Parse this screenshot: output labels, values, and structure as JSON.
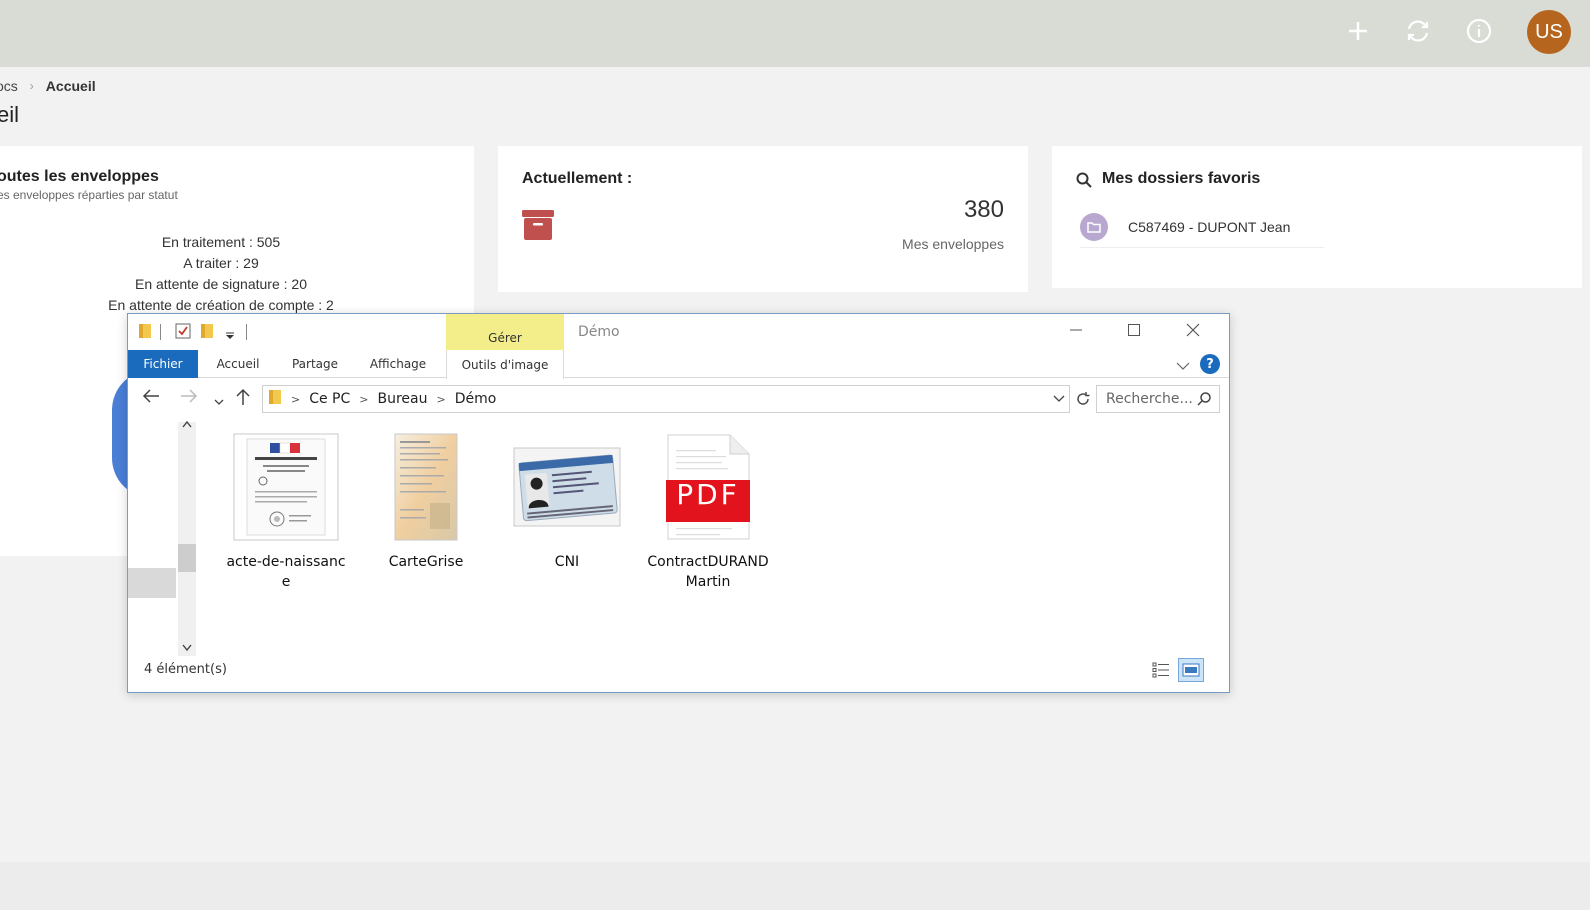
{
  "topbar": {
    "icons": [
      "plus-icon",
      "sync-icon",
      "info-icon"
    ],
    "avatar_initials": "US",
    "avatar_color": "#b5651d",
    "background": "#d8dcd4"
  },
  "breadcrumb": {
    "previous": "ocs",
    "current": "Accueil"
  },
  "page_title": "eil",
  "cards": {
    "envelopes": {
      "title": "outes les enveloppes",
      "subtitle": "es enveloppes réparties par statut",
      "stats": [
        "En traitement : 505",
        "A traiter : 29",
        "En attente de signature : 20",
        "En attente de création de compte : 2"
      ]
    },
    "current": {
      "title": "Actuellement :",
      "count": "380",
      "count_label": "Mes enveloppes",
      "icon": "archive-box-icon",
      "icon_color": "#c0504d"
    },
    "favorites": {
      "title": "Mes dossiers favoris",
      "items": [
        "C587469 - DUPONT Jean"
      ]
    }
  },
  "explorer": {
    "title": "Démo",
    "contextual_tab": "Gérer",
    "ribbon_tabs": [
      "Fichier",
      "Accueil",
      "Partage",
      "Affichage",
      "Outils d'image"
    ],
    "address": [
      "Ce PC",
      "Bureau",
      "Démo"
    ],
    "search_placeholder": "Recherche...",
    "files": [
      {
        "name": "acte-de-naissance",
        "type": "document-thumbnail"
      },
      {
        "name": "CarteGrise",
        "type": "scan-thumbnail"
      },
      {
        "name": "CNI",
        "type": "id-card-thumbnail"
      },
      {
        "name": "ContractDURANDMartin",
        "type": "pdf-icon",
        "pdf_label": "PDF"
      }
    ],
    "status": "4 élément(s)",
    "help": "?"
  }
}
